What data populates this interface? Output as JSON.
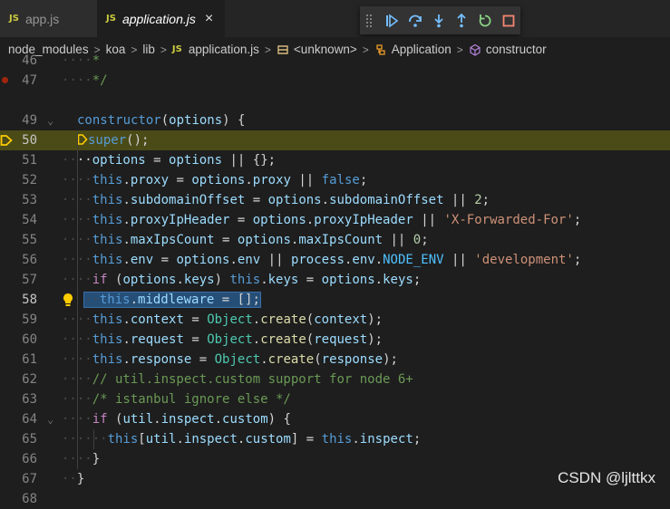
{
  "tabs": [
    {
      "label": "app.js",
      "badge": "JS"
    },
    {
      "label": "application.js",
      "badge": "JS",
      "close": "×"
    }
  ],
  "debug_toolbar": {
    "buttons": [
      "continue-icon",
      "step-over-icon",
      "step-into-icon",
      "step-out-icon",
      "restart-icon",
      "stop-icon"
    ],
    "colors": {
      "blue": "#75beff",
      "green": "#89d185",
      "red": "#f48771"
    }
  },
  "breadcrumb": {
    "items": [
      "node_modules",
      "koa",
      "lib",
      "application.js",
      "<unknown>",
      "Application",
      "constructor"
    ],
    "separator": ">",
    "file_badge": "JS"
  },
  "editor": {
    "lines": [
      {
        "num": "46",
        "text": "*"
      },
      {
        "num": "47",
        "text": "*/"
      },
      {
        "num": "49",
        "text": "constructor(options) {"
      },
      {
        "num": "50",
        "text": "super();"
      },
      {
        "num": "51",
        "text": "options = options || {};"
      },
      {
        "num": "52",
        "text": "this.proxy = options.proxy || false;"
      },
      {
        "num": "53",
        "text": "this.subdomainOffset = options.subdomainOffset || 2;"
      },
      {
        "num": "54",
        "text": "this.proxyIpHeader = options.proxyIpHeader || 'X-Forwarded-For';"
      },
      {
        "num": "55",
        "text": "this.maxIpsCount = options.maxIpsCount || 0;"
      },
      {
        "num": "56",
        "text": "this.env = options.env || process.env.NODE_ENV || 'development';"
      },
      {
        "num": "57",
        "text": "if (options.keys) this.keys = options.keys;"
      },
      {
        "num": "58",
        "text": "this.middleware = [];"
      },
      {
        "num": "59",
        "text": "this.context = Object.create(context);"
      },
      {
        "num": "60",
        "text": "this.request = Object.create(request);"
      },
      {
        "num": "61",
        "text": "this.response = Object.create(response);"
      },
      {
        "num": "62",
        "text": "// util.inspect.custom support for node 6+"
      },
      {
        "num": "63",
        "text": "/* istanbul ignore else */"
      },
      {
        "num": "64",
        "text": "if (util.inspect.custom) {"
      },
      {
        "num": "65",
        "text": "this[util.inspect.custom] = this.inspect;"
      },
      {
        "num": "66",
        "text": "}"
      },
      {
        "num": "67",
        "text": "}"
      },
      {
        "num": "68",
        "text": ""
      }
    ],
    "current_line": "50",
    "selected_line": "58",
    "highlight_color": "#4b4b18",
    "breakpoint_line": "47",
    "breakpoint_color": "#a1260d"
  },
  "watermark": "CSDN @ljlttkx"
}
